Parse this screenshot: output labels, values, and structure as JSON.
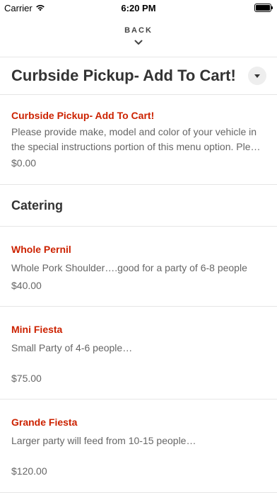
{
  "status_bar": {
    "carrier": "Carrier",
    "time": "6:20 PM"
  },
  "nav": {
    "back_label": "BACK"
  },
  "menu_section": {
    "title": "Curbside Pickup- Add To Cart!"
  },
  "curbside_item": {
    "name": "Curbside Pickup- Add To Cart!",
    "description_line1": "Please provide make, model and color of your vehicle in",
    "description_line2": "the special instructions portion of this menu option. Ple…",
    "price": "$0.00"
  },
  "catering": {
    "title": "Catering",
    "items": [
      {
        "name": "Whole Pernil",
        "description": "Whole Pork Shoulder….good for a party of 6-8 people",
        "price": "$40.00"
      },
      {
        "name": "Mini Fiesta",
        "description": "Small Party of 4-6 people…",
        "price": "$75.00"
      },
      {
        "name": "Grande Fiesta",
        "description": "Larger party will feed from 10-15 people…",
        "price": "$120.00"
      }
    ]
  },
  "colors": {
    "accent": "#cc2200",
    "divider": "#e6e6e6"
  }
}
